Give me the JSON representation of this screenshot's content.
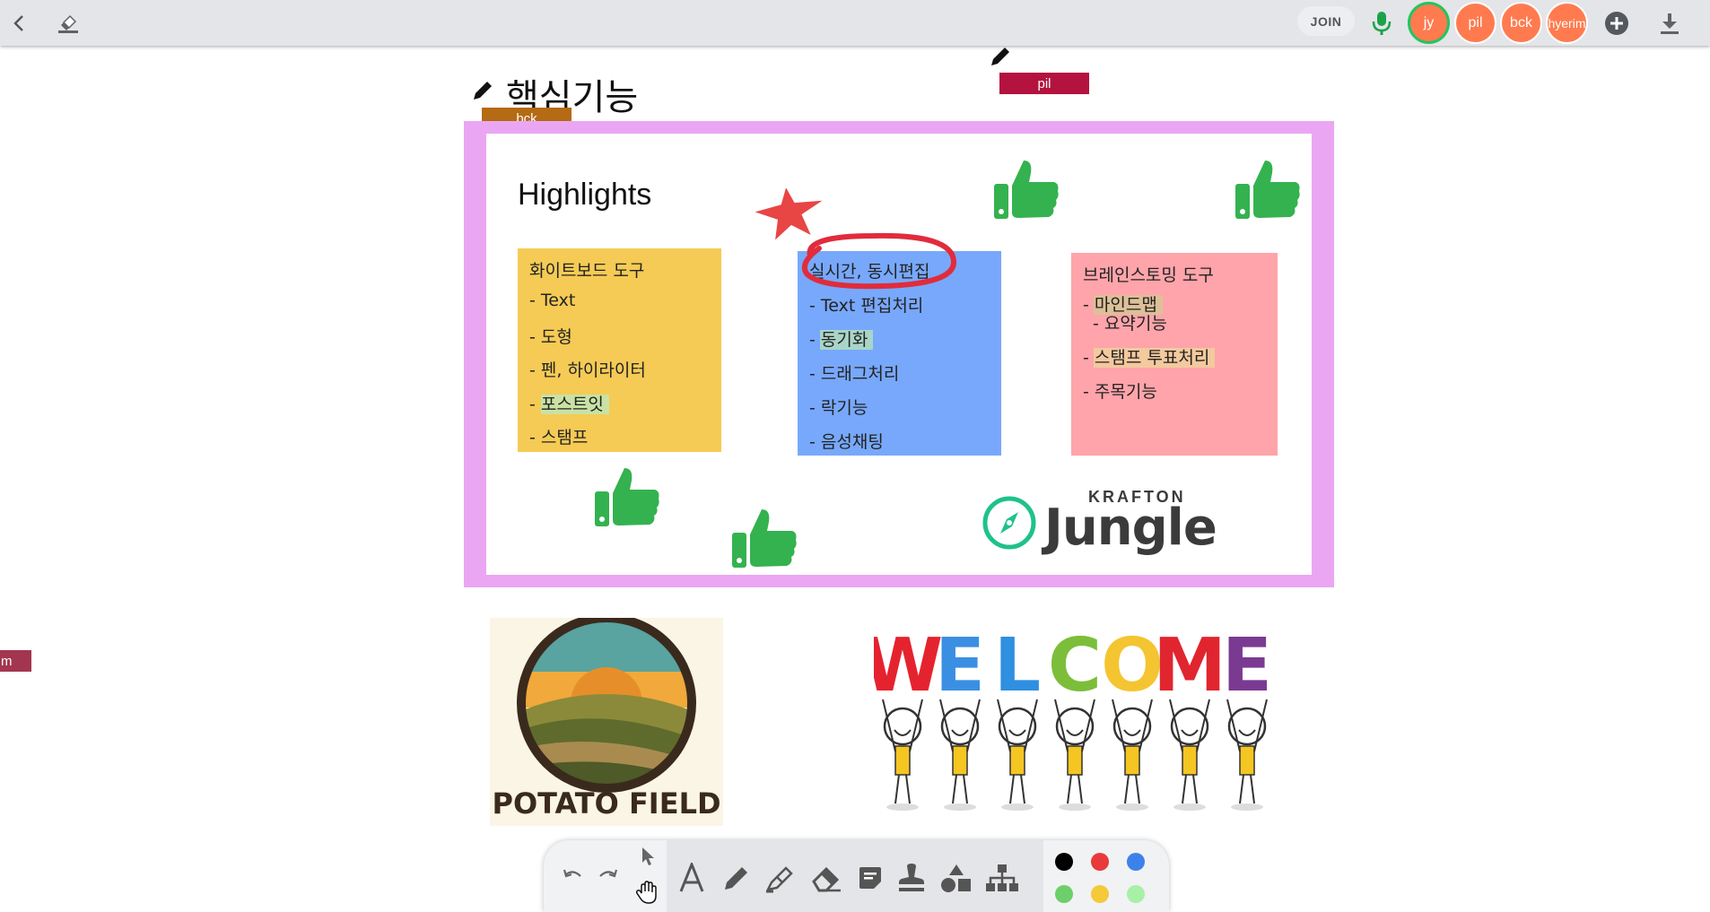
{
  "topbar": {
    "join_label": "JOIN",
    "avatars": [
      {
        "label": "jy",
        "active": true
      },
      {
        "label": "pil",
        "active": false
      },
      {
        "label": "bck",
        "active": false
      },
      {
        "label": "hyerim",
        "active": false
      }
    ]
  },
  "board": {
    "title": "핵심기능",
    "cursors": [
      {
        "user": "bck",
        "color": "#b56a14"
      },
      {
        "user": "pil",
        "color": "#b4133f"
      },
      {
        "user": "m",
        "color": "#a3364f"
      }
    ],
    "highlights_title": "Highlights",
    "stickies": [
      {
        "color": "#f5cb55",
        "title": "화이트보드 도구",
        "items": [
          "- Text",
          "- 도형",
          "- 펜, 하이라이터",
          "- 포스트잇",
          "- 스탬프"
        ]
      },
      {
        "color": "#78a8fb",
        "title": "실시간, 동시편집",
        "items": [
          "- Text 편집처리",
          "- 동기화",
          "- 드래그처리",
          "- 락기능",
          "- 음성채팅"
        ]
      },
      {
        "color": "#fea4aa",
        "title": "브레인스토밍 도구",
        "items": [
          "- 마인드맵",
          "- 요약기능",
          "- 스탬프 투표처리",
          "- 주목기능"
        ]
      }
    ],
    "logo": {
      "top": "KRAFTON",
      "main": "Jungle"
    },
    "potato_text": "POTATO FIELD",
    "welcome_letters": [
      "W",
      "E",
      "L",
      "C",
      "O",
      "M",
      "E"
    ],
    "welcome_colors": [
      "#e5232f",
      "#3a8fe3",
      "#2f8fe0",
      "#7cbe3a",
      "#f4c531",
      "#e1252f",
      "#7b3a92"
    ]
  },
  "colors": {
    "row1": [
      "#000000",
      "#e83a3a",
      "#3d82ea"
    ],
    "row2": [
      "#6ccf6a",
      "#f4c93a",
      "#a8f0a6"
    ]
  },
  "icons": {
    "back": "chevron-left-icon",
    "clear": "eraser-icon",
    "mic": "microphone-icon",
    "add": "plus-circle-icon",
    "download": "download-icon"
  }
}
